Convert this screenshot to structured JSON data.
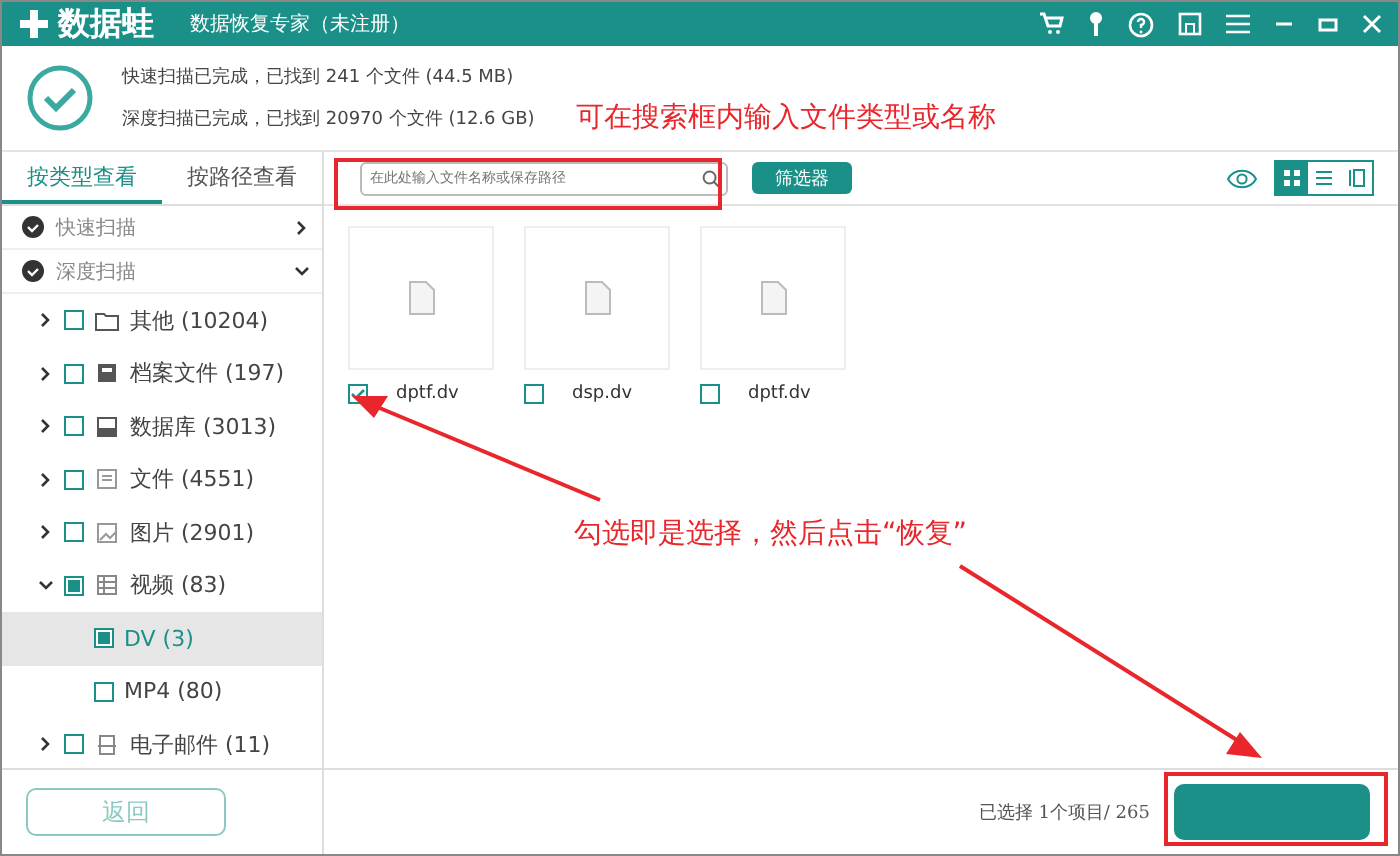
{
  "window": {
    "app_name": "数据蛙",
    "subtitle": "数据恢复专家（未注册）"
  },
  "scan_summary": [
    "快速扫描已完成，已找到 241 个文件 (44.5 MB)",
    "深度扫描已完成，已找到 20970 个文件 (12.6 GB)"
  ],
  "tabs": [
    {
      "label": "按类型查看",
      "selected": true
    },
    {
      "label": "按路径查看",
      "selected": false
    }
  ],
  "scans": [
    {
      "label": "快速扫描",
      "expanded": false
    },
    {
      "label": "深度扫描",
      "expanded": true
    }
  ],
  "tree": [
    {
      "label": "其他 (10204)",
      "expanded": false,
      "checked": false
    },
    {
      "label": "档案文件 (197)",
      "expanded": false,
      "checked": false
    },
    {
      "label": "数据库 (3013)",
      "expanded": false,
      "checked": false
    },
    {
      "label": "文件 (4551)",
      "expanded": false,
      "checked": false
    },
    {
      "label": "图片 (2901)",
      "expanded": false,
      "checked": false
    },
    {
      "label": "视频 (83)",
      "expanded": true,
      "checked": true,
      "children": [
        {
          "label": "DV (3)",
          "selected": true,
          "checked": true
        },
        {
          "label": "MP4 (80)",
          "selected": false,
          "checked": false
        }
      ]
    },
    {
      "label": "电子邮件 (11)",
      "expanded": false,
      "checked": false
    }
  ],
  "search": {
    "placeholder": "在此处输入文件名称或保存路径"
  },
  "filter_button": "筛选器",
  "view_modes": [
    {
      "selected": true
    },
    {
      "selected": false
    },
    {
      "selected": false
    }
  ],
  "files": [
    {
      "name": "dptf.dv",
      "checked": true
    },
    {
      "name": "dsp.dv",
      "checked": false
    },
    {
      "name": "dptf.dv",
      "checked": false
    }
  ],
  "back_button": "返回",
  "status": "已选择 1个项目/ 265",
  "annotations": [
    "可在搜索框内输入文件类型或名称",
    "勾选即是选择，然后点击“恢复”"
  ]
}
